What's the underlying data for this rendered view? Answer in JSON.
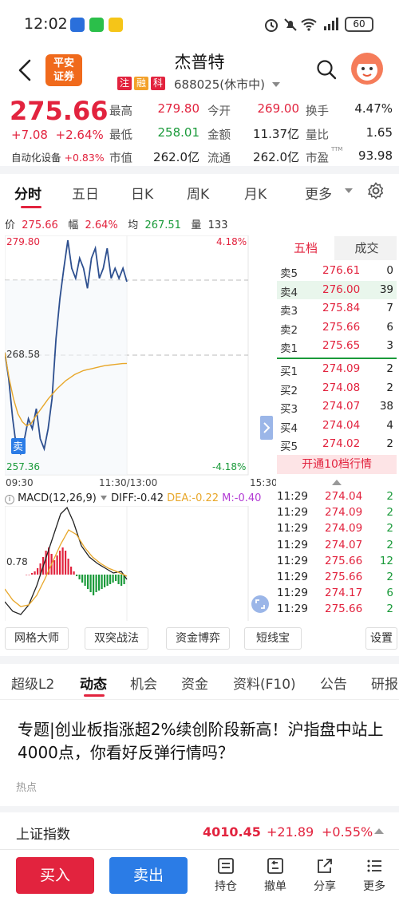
{
  "status_bar": {
    "time": "12:02",
    "signal": "4G",
    "battery": "60"
  },
  "header": {
    "brand_line1": "平安",
    "brand_line2": "证券",
    "stock_name": "杰普特",
    "tags": [
      {
        "text": "注",
        "color": "#e2233e"
      },
      {
        "text": "融",
        "color": "#f3a12a"
      },
      {
        "text": "科",
        "color": "#e2233e"
      }
    ],
    "stock_code": "688025(休市中)"
  },
  "quote": {
    "price": "275.66",
    "change": "+7.08",
    "change_pct": "+2.64%",
    "sector_label": "自动化设备",
    "sector_pct": "+0.83%",
    "fields": [
      {
        "label": "最高",
        "value": "279.80",
        "color": "#e2233e"
      },
      {
        "label": "今开",
        "value": "269.00",
        "color": "#e2233e"
      },
      {
        "label": "换手",
        "value": "4.47%",
        "color": "#222222"
      },
      {
        "label": "最低",
        "value": "258.01",
        "color": "#1a9a3a"
      },
      {
        "label": "金额",
        "value": "11.37亿",
        "color": "#222222"
      },
      {
        "label": "量比",
        "value": "1.65",
        "color": "#222222"
      },
      {
        "label": "市值",
        "value": "262.0亿",
        "color": "#222222"
      },
      {
        "label": "流通",
        "value": "262.0亿",
        "color": "#222222"
      },
      {
        "label": "市盈",
        "value": "93.98",
        "color": "#222222",
        "sup": "TTM"
      }
    ]
  },
  "chart_tabs": [
    "分时",
    "五日",
    "日K",
    "周K",
    "月K",
    "更多"
  ],
  "info_line": {
    "price_label": "价",
    "price": "275.66",
    "amp_label": "幅",
    "amp": "2.64%",
    "avg_label": "均",
    "avg": "267.51",
    "vol_label": "量",
    "vol": "133"
  },
  "chart": {
    "y_top": "279.80",
    "y_mid": "268.58",
    "y_bottom": "257.36",
    "pct_top": "4.18%",
    "pct_bottom": "-4.18%",
    "x_start": "09:30",
    "x_mid": "11:30/13:00",
    "x_end": "15:30",
    "sell_marker": "卖",
    "macd_label": "MACD(12,26,9)",
    "diff": "DIFF:-0.42",
    "dea": "DEA:-0.22",
    "m": "M:-0.40",
    "macd_level": "0.78"
  },
  "chart_data": {
    "type": "line",
    "series": [
      {
        "values": [
          268.6,
          266,
          262,
          259,
          258.5,
          260,
          262,
          261,
          263,
          260,
          259,
          261,
          264,
          270,
          274,
          277,
          279.8,
          277,
          276,
          278,
          277,
          275,
          278,
          279,
          276,
          277,
          279,
          276,
          277,
          276,
          277,
          275.66
        ]
      },
      {
        "values": [
          268.6,
          266,
          264,
          262.5,
          261.7,
          261.3,
          261.5,
          262.2,
          262.8,
          263.4,
          264,
          264.5,
          265,
          265.4,
          265.8,
          266.1,
          266.4,
          266.6,
          266.8,
          266.9,
          267,
          267.1,
          267.2,
          267.3,
          267.35,
          267.4,
          267.45,
          267.5,
          267.51
        ]
      }
    ],
    "ylim": [
      257.36,
      279.8
    ]
  },
  "order_book": {
    "tab_five": "五档",
    "tab_trades": "成交",
    "asks": [
      {
        "label": "卖5",
        "price": "276.61",
        "vol": "0"
      },
      {
        "label": "卖4",
        "price": "276.00",
        "vol": "39"
      },
      {
        "label": "卖3",
        "price": "275.84",
        "vol": "7"
      },
      {
        "label": "卖2",
        "price": "275.66",
        "vol": "6"
      },
      {
        "label": "卖1",
        "price": "275.65",
        "vol": "3"
      }
    ],
    "bids": [
      {
        "label": "买1",
        "price": "274.09",
        "vol": "2"
      },
      {
        "label": "买2",
        "price": "274.08",
        "vol": "2"
      },
      {
        "label": "买3",
        "price": "274.07",
        "vol": "38"
      },
      {
        "label": "买4",
        "price": "274.04",
        "vol": "4"
      },
      {
        "label": "买5",
        "price": "274.02",
        "vol": "2"
      }
    ],
    "open_level10": "开通10档行情"
  },
  "trades": [
    {
      "time": "11:29",
      "price": "274.04",
      "vol": "2"
    },
    {
      "time": "11:29",
      "price": "274.09",
      "vol": "2"
    },
    {
      "time": "11:29",
      "price": "274.09",
      "vol": "2"
    },
    {
      "time": "11:29",
      "price": "274.07",
      "vol": "2"
    },
    {
      "time": "11:29",
      "price": "275.66",
      "vol": "12"
    },
    {
      "time": "11:29",
      "price": "275.66",
      "vol": "2"
    },
    {
      "time": "11:29",
      "price": "274.17",
      "vol": "6"
    },
    {
      "time": "11:29",
      "price": "275.66",
      "vol": "2"
    }
  ],
  "tools": [
    "网格大师",
    "双突战法",
    "资金博弈",
    "短线宝",
    "设置"
  ],
  "lower_tabs": [
    "超级L2",
    "动态",
    "机会",
    "资金",
    "资料(F10)",
    "公告",
    "研报"
  ],
  "news": {
    "title": "专题|创业板指涨超2%续创阶段新高！沪指盘中站上4000点，你看好反弹行情吗？",
    "tag": "热点"
  },
  "index_ticker": {
    "name": "上证指数",
    "value": "4010.45",
    "change": "+21.89",
    "pct": "+0.55%"
  },
  "bottom_bar": {
    "buy": "买入",
    "sell": "卖出",
    "items": [
      "持仓",
      "撤单",
      "分享",
      "更多"
    ]
  }
}
